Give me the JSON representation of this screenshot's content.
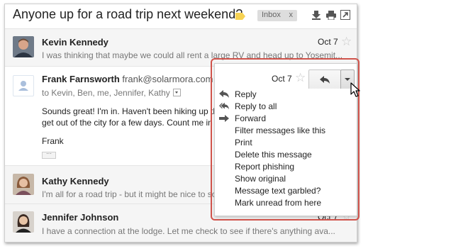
{
  "thread": {
    "subject": "Anyone up for a road trip next weekend?",
    "label_chip": "Inbox",
    "label_remove": "x",
    "label_color": "#f6d253"
  },
  "messages": [
    {
      "sender": "Kevin Kennedy",
      "date": "Oct 7",
      "snippet": "I was thinking that maybe we could all rent a large RV and head up to Yosemit..."
    },
    {
      "sender": "Frank Farnsworth",
      "email": "frank@solarmora.com",
      "date": "Oct 7",
      "to": "to Kevin, Ben, me, Jennifer, Kathy",
      "body_line1": "Sounds great! I'm in. Haven't been hiking up th",
      "body_line2": "get out of the city for a few days. Count me in",
      "signature": "Frank",
      "quoted_toggle": "···"
    },
    {
      "sender": "Kathy Kennedy",
      "snippet": "I'm all for a road trip - but it might be nice to so"
    },
    {
      "sender": "Jennifer Johnson",
      "date": "Oct 7",
      "snippet": "I have a connection at the lodge. Let me check to see if there's anything ava..."
    }
  ],
  "menu": {
    "items": [
      {
        "label": "Reply",
        "icon": "reply-icon"
      },
      {
        "label": "Reply to all",
        "icon": "reply-all-icon"
      },
      {
        "label": "Forward",
        "icon": "forward-icon"
      },
      {
        "label": "Filter messages like this"
      },
      {
        "label": "Print"
      },
      {
        "label": "Delete this message"
      },
      {
        "label": "Report phishing"
      },
      {
        "label": "Show original"
      },
      {
        "label": "Message text garbled?"
      },
      {
        "label": "Mark unread from here"
      }
    ]
  },
  "colors": {
    "highlight": "#d0534b",
    "collapsed_bg": "#f5f5f5",
    "chip_bg": "#dddddd"
  }
}
